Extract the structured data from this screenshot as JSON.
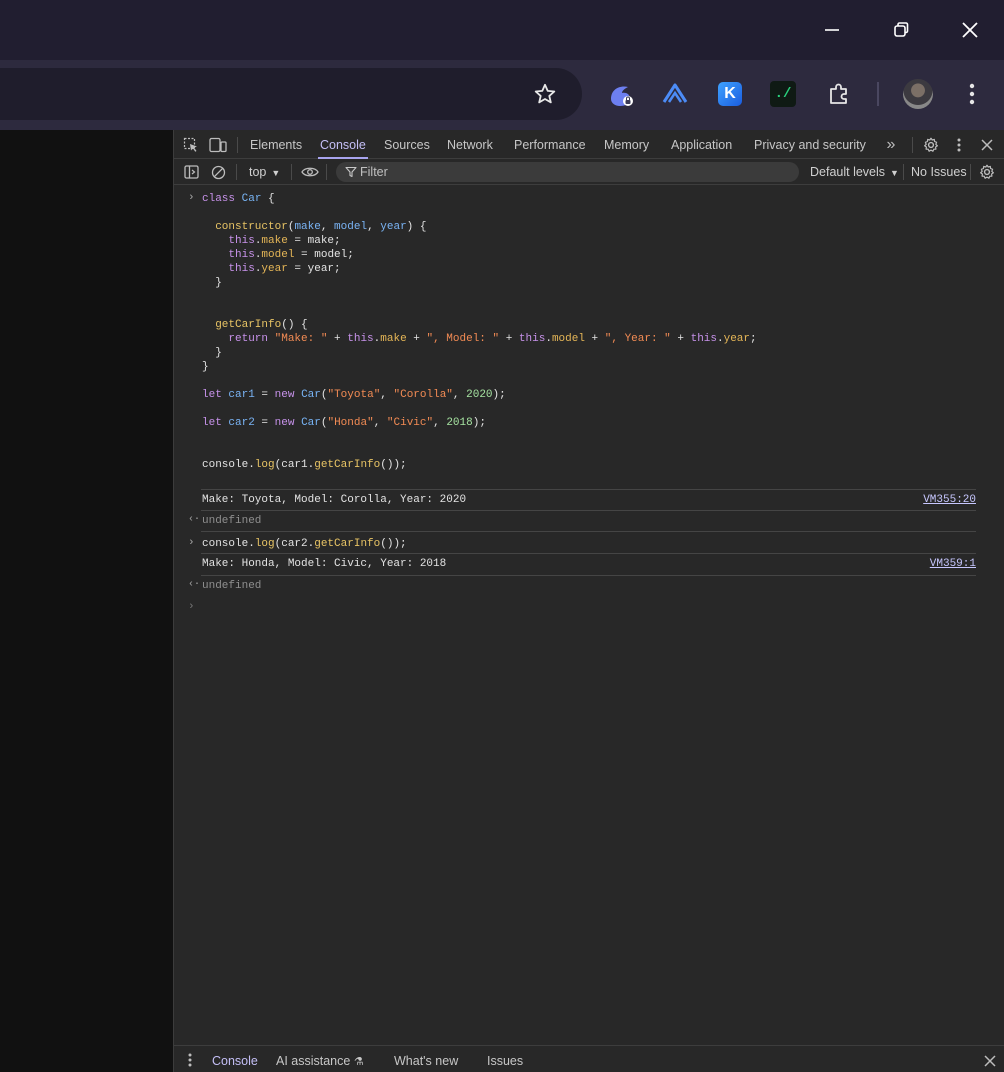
{
  "window": {
    "minimize_label": "—",
    "restore_label": "❐",
    "close_label": "✕"
  },
  "toolbar": {
    "bookmark_icon": "star-outline-icon",
    "extensions": [
      "rabbit-extension-icon",
      "arc-extension-icon",
      "k-extension-icon",
      "terminal-extension-icon",
      "puzzle-extensions-icon"
    ],
    "k_letter": "K",
    "term_glyph": "./"
  },
  "devtools": {
    "tabs": [
      "Elements",
      "Console",
      "Sources",
      "Network",
      "Performance",
      "Memory",
      "Application",
      "Privacy and security"
    ],
    "active_tab": "Console",
    "more_tabs": "»",
    "context": "top",
    "filter_placeholder": "Filter",
    "levels": "Default levels",
    "issues": "No Issues",
    "accent": "#a8a4ef"
  },
  "console": {
    "code": {
      "l1": "class Car {",
      "constructor_sig": [
        "constructor(",
        "make",
        ", ",
        "model",
        ", ",
        "year",
        ") {"
      ],
      "assign": [
        {
          "prop": "make",
          "val": "make"
        },
        {
          "prop": "model",
          "val": "model"
        },
        {
          "prop": "year",
          "val": "year"
        }
      ],
      "close_brace": "}",
      "method": "getCarInfo",
      "ret_parts": {
        "s1": "\"Make: \"",
        "s2": "\", Model: \"",
        "s3": "\", Year: \"",
        "p1": "make",
        "p2": "model",
        "p3": "year"
      },
      "car1": {
        "var": "car1",
        "make": "\"Toyota\"",
        "model": "\"Corolla\"",
        "year": "2020"
      },
      "car2": {
        "var": "car2",
        "make": "\"Honda\"",
        "model": "\"Civic\"",
        "year": "2018"
      },
      "log1": "console.log(car1.getCarInfo());",
      "log2": "console.log(car2.getCarInfo());"
    },
    "out1": {
      "text": "Make: Toyota, Model: Corolla, Year: 2020",
      "source": "VM355:20"
    },
    "out2": {
      "text": "Make: Honda, Model: Civic, Year: 2018",
      "source": "VM359:1"
    },
    "undefined": "undefined"
  },
  "drawer": {
    "tabs": [
      "Console",
      "AI assistance",
      "What's new",
      "Issues"
    ],
    "active": "Console"
  }
}
